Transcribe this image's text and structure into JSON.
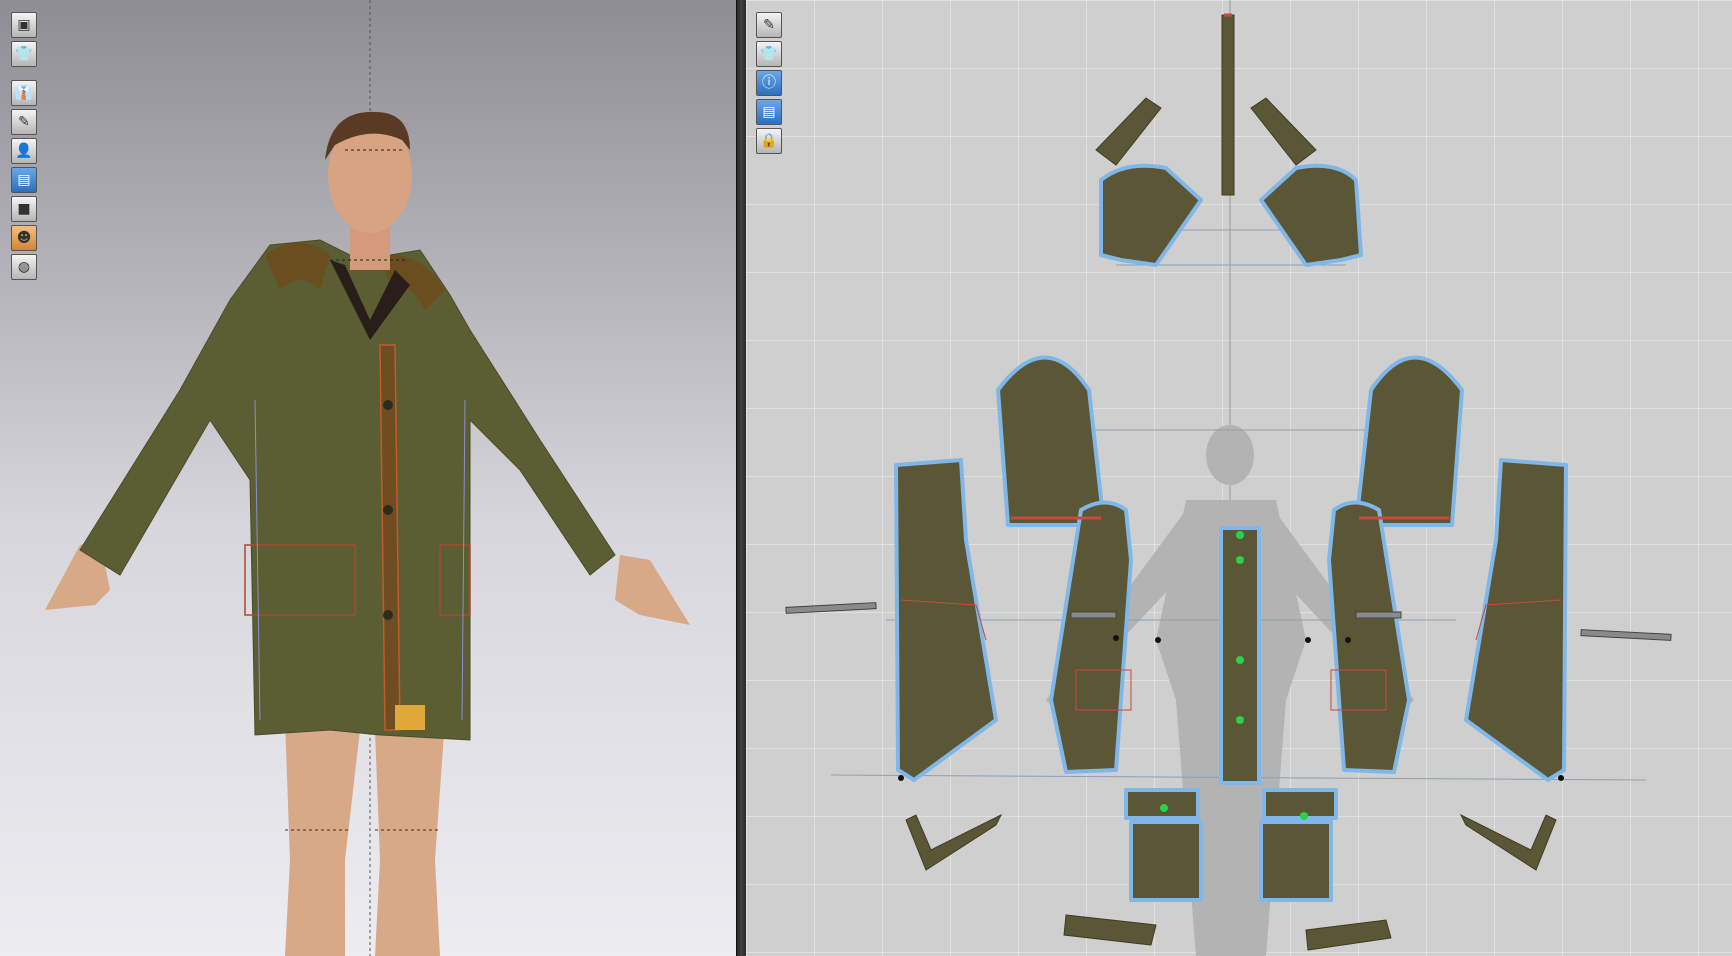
{
  "app": {
    "accent": "#3b82d0",
    "fabric_color": "#5b5736",
    "seam_color": "#c84a3a",
    "outline_color": "#7fb8e8"
  },
  "viewport3d": {
    "toolbar": [
      {
        "icon": "cube-icon",
        "glyph": "▣"
      },
      {
        "icon": "shirt-icon",
        "glyph": "👕"
      },
      {
        "icon": "garment-view-icon",
        "glyph": "👔"
      },
      {
        "icon": "eye-brush-icon",
        "glyph": "✎"
      },
      {
        "icon": "avatar-icon",
        "glyph": "👤"
      },
      {
        "icon": "texture-icon",
        "glyph": "▤",
        "active": true
      },
      {
        "icon": "black-square-icon",
        "glyph": "■"
      },
      {
        "icon": "skin-avatar-icon",
        "glyph": "☻",
        "orange": true
      },
      {
        "icon": "globe-icon",
        "glyph": "◍"
      }
    ]
  },
  "viewport2d": {
    "toolbar": [
      {
        "icon": "pen-icon",
        "glyph": "✎"
      },
      {
        "icon": "shirt-icon",
        "glyph": "👕"
      },
      {
        "icon": "info-icon",
        "glyph": "ⓘ",
        "active": true
      },
      {
        "icon": "texture-icon",
        "glyph": "▤",
        "active": true
      },
      {
        "icon": "lock-shirt-icon",
        "glyph": "🔒"
      }
    ]
  }
}
